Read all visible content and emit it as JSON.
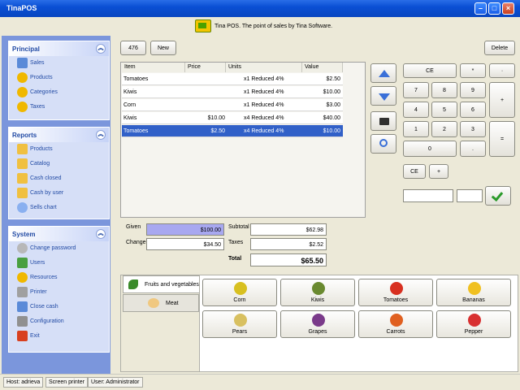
{
  "window": {
    "title": "TinaPOS"
  },
  "banner": {
    "text": "Tina POS. The point of sales by Tina Software."
  },
  "sidebar": {
    "principal": {
      "title": "Principal",
      "items": [
        "Sales",
        "Products",
        "Categories",
        "Taxes"
      ]
    },
    "reports": {
      "title": "Reports",
      "items": [
        "Products",
        "Catalog",
        "Cash closed",
        "Cash by user",
        "Sells chart"
      ]
    },
    "system": {
      "title": "System",
      "items": [
        "Change password",
        "Users",
        "Resources",
        "Printer",
        "Close cash",
        "Configuration",
        "Exit"
      ]
    }
  },
  "toolbar": {
    "ticket_number": "476",
    "new_label": "New",
    "delete_label": "Delete"
  },
  "ticket": {
    "columns": [
      "Item",
      "Price",
      "Units",
      "Value"
    ],
    "rows": [
      {
        "item": "Tomatoes",
        "price": "",
        "units": "x1 Reduced 4%",
        "value": "$2.50"
      },
      {
        "item": "Kiwis",
        "price": "",
        "units": "x1 Reduced 4%",
        "value": "$10.00"
      },
      {
        "item": "Corn",
        "price": "",
        "units": "x1 Reduced 4%",
        "value": "$3.00"
      },
      {
        "item": "Kiwis",
        "price": "$10.00",
        "units": "x4 Reduced 4%",
        "value": "$40.00"
      },
      {
        "item": "Tomatoes",
        "price": "$2.50",
        "units": "x4 Reduced 4%",
        "value": "$10.00"
      }
    ]
  },
  "totals": {
    "given_label": "Given",
    "given": "$100.00",
    "change_label": "Change",
    "change": "$34.50",
    "subtotal_label": "Subtotal",
    "subtotal": "$62.98",
    "taxes_label": "Taxes",
    "taxes": "$2.52",
    "total_label": "Total",
    "total": "$65.50"
  },
  "keypad": {
    "ce": "CE",
    "star": "*",
    "dot_top": "·",
    "k7": "7",
    "k8": "8",
    "k9": "9",
    "plus": "+",
    "k4": "4",
    "k5": "5",
    "k6": "6",
    "k1": "1",
    "k2": "2",
    "k3": "3",
    "equals": "=",
    "k0": "0",
    "dot": ".",
    "ce2": "CE",
    "plus2": "+"
  },
  "catalog": {
    "categories": [
      "Fruits and vegetables",
      "Meat"
    ],
    "products": [
      "Corn",
      "Kiwis",
      "Tomatoes",
      "Bananas",
      "Pears",
      "Grapes",
      "Carrots",
      "Pepper"
    ]
  },
  "status": {
    "host": "Host: adrieva",
    "printer": "Screen printer",
    "user": "User: Administrator"
  },
  "colors": {
    "accent": "#3160c8",
    "sidebar": "#7b96dc",
    "given_field": "#a8a8f0"
  }
}
